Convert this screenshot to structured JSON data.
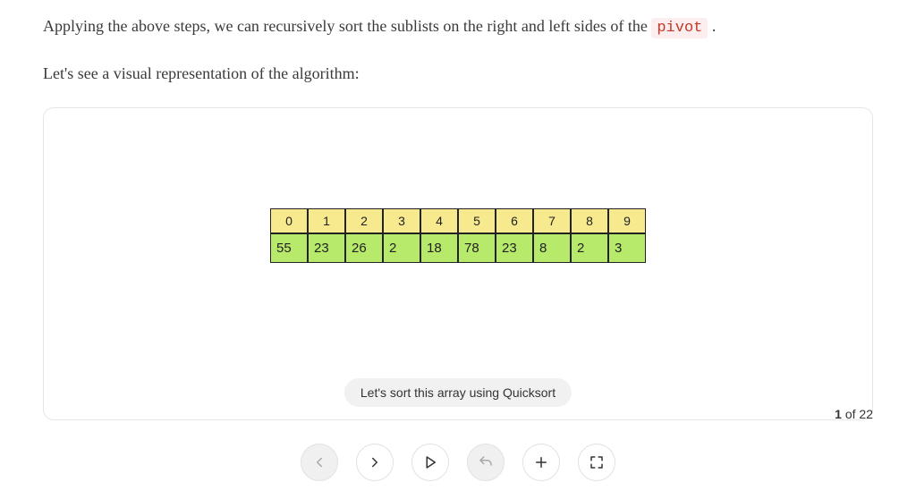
{
  "paragraphs": {
    "p1_prefix": "Applying the above steps, we can recursively sort the sublists on the right and left sides of the ",
    "p1_code": "pivot",
    "p1_suffix": " .",
    "p2": "Let's see a visual representation of the algorithm:"
  },
  "array": {
    "indices": [
      "0",
      "1",
      "2",
      "3",
      "4",
      "5",
      "6",
      "7",
      "8",
      "9"
    ],
    "values": [
      "55",
      "23",
      "26",
      "2",
      "18",
      "78",
      "23",
      "8",
      "2",
      "3"
    ]
  },
  "caption": "Let's sort this array using Quicksort",
  "pager": {
    "current": "1",
    "of": " of ",
    "total": "22"
  },
  "controls": {
    "prev": "previous-button",
    "next": "next-button",
    "play": "play-button",
    "restart": "restart-button",
    "zoom": "zoom-button",
    "fullscreen": "fullscreen-button"
  }
}
